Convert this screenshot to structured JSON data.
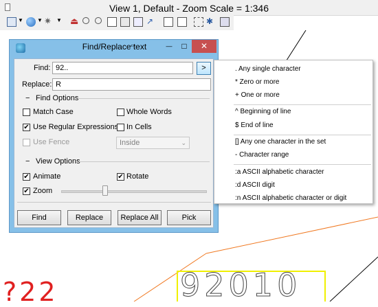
{
  "view_window": {
    "title": "View 1, Default - Zoom Scale = 1:346"
  },
  "drawing": {
    "label_red": "?22",
    "label_yellow": "92010"
  },
  "dialog": {
    "title": "Find/Replace text",
    "find_label": "Find:",
    "find_value": "92..",
    "menu_button_label": ">",
    "replace_label": "Replace:",
    "replace_value": "R",
    "find_options_title": "Find Options",
    "match_case": "Match Case",
    "whole_words": "Whole Words",
    "use_regex": "Use Regular Expressions",
    "in_cells": "In Cells",
    "use_fence": "Use Fence",
    "fence_mode": "Inside",
    "view_options_title": "View Options",
    "animate": "Animate",
    "rotate": "Rotate",
    "zoom": "Zoom",
    "zoom_level": 0.3,
    "buttons": {
      "find": "Find",
      "replace": "Replace",
      "replace_all": "Replace All",
      "pick": "Pick"
    },
    "collapse_glyph": "−",
    "check_glyph": "✔",
    "min_glyph": "—",
    "max_glyph": "□",
    "close_glyph": "✕"
  },
  "checks": {
    "match_case": false,
    "whole_words": false,
    "use_regex": true,
    "in_cells": false,
    "use_fence": false,
    "animate": true,
    "rotate": true,
    "zoom": true
  },
  "popup_menu": {
    "items": [
      ". Any single character",
      "* Zero or more",
      "+ One or more",
      "^ Beginning of line",
      "$ End of line",
      "[] Any one character in the set",
      "- Character range",
      ":a ASCII alphabetic character",
      ":d ASCII digit",
      ":n ASCII alphabetic character or digit"
    ]
  },
  "colors": {
    "dialog_frame": "#86c0e8",
    "close_button": "#c75050",
    "red_text": "#e02020",
    "yellow_box": "#f0f000",
    "orange_line": "#f07820"
  }
}
